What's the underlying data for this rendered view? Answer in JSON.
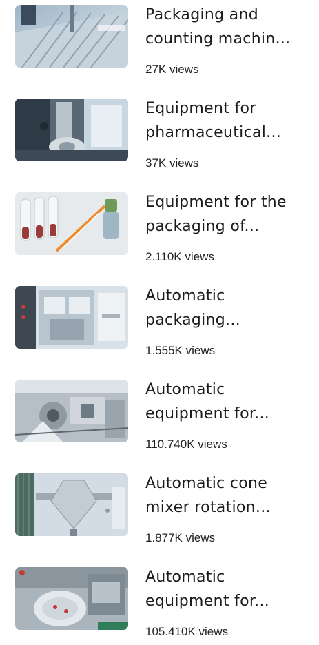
{
  "videos": [
    {
      "title": "Packaging and\ncounting machin...",
      "views": "27K views",
      "thumbnail": "packaging-counting-machine-thumbnail"
    },
    {
      "title": "Equipment for\npharmaceutical...",
      "views": "37K views",
      "thumbnail": "pharmaceutical-equipment-thumbnail"
    },
    {
      "title": "Equipment for the\npackaging of...",
      "views": "2.110K views",
      "thumbnail": "syringe-vials-thumbnail"
    },
    {
      "title": "Automatic\npackaging...",
      "views": "1.555K views",
      "thumbnail": "automatic-packaging-machine-thumbnail"
    },
    {
      "title": "Automatic\nequipment for...",
      "views": "110.740K views",
      "thumbnail": "metal-machinery-thumbnail"
    },
    {
      "title": "Automatic cone\nmixer rotation...",
      "views": "1.877K views",
      "thumbnail": "cone-mixer-thumbnail"
    },
    {
      "title": "Automatic\nequipment for...",
      "views": "105.410K views",
      "thumbnail": "blister-equipment-thumbnail"
    }
  ]
}
